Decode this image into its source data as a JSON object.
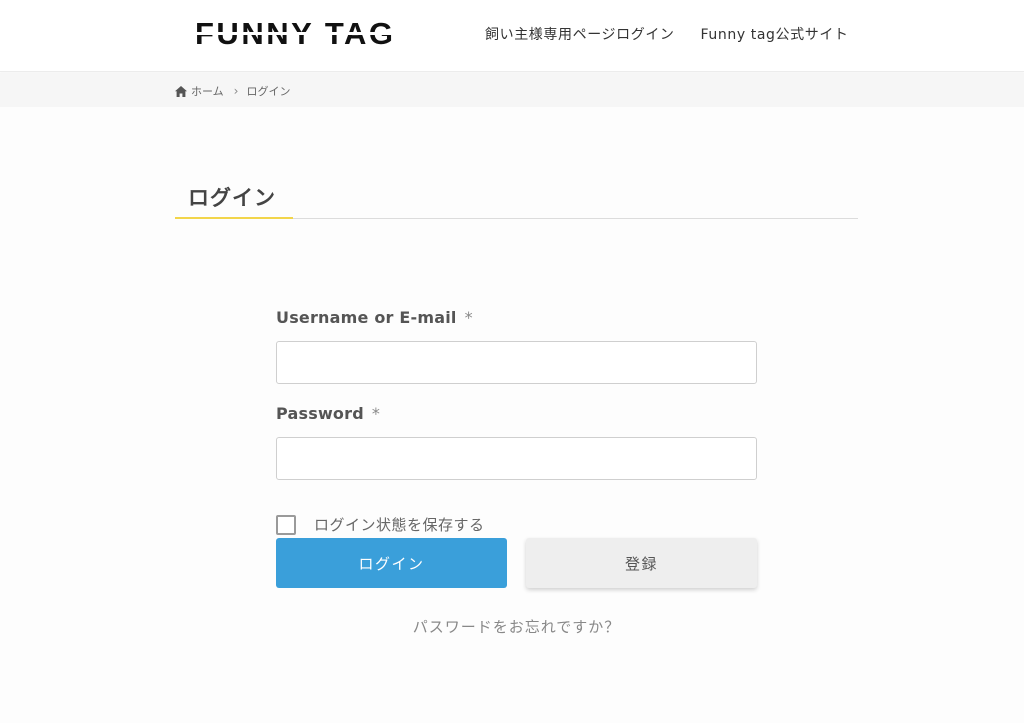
{
  "header": {
    "logo_text": "FUNNY TAG",
    "nav": [
      {
        "label": "飼い主様専用ページログイン"
      },
      {
        "label": "Funny tag公式サイト"
      }
    ]
  },
  "breadcrumb": {
    "home_icon": "home-icon",
    "home_label": "ホーム",
    "separator": "›",
    "current": "ログイン"
  },
  "page": {
    "title": "ログイン",
    "accent_color": "#f2d54a"
  },
  "form": {
    "username_label": "Username or E-mail",
    "username_required": "*",
    "username_value": "",
    "password_label": "Password",
    "password_required": "*",
    "password_value": "",
    "remember_label": "ログイン状態を保存する",
    "remember_checked": false,
    "login_button": "ログイン",
    "register_button": "登録",
    "forgot_link": "パスワードをお忘れですか？",
    "primary_color": "#3a9fda"
  }
}
